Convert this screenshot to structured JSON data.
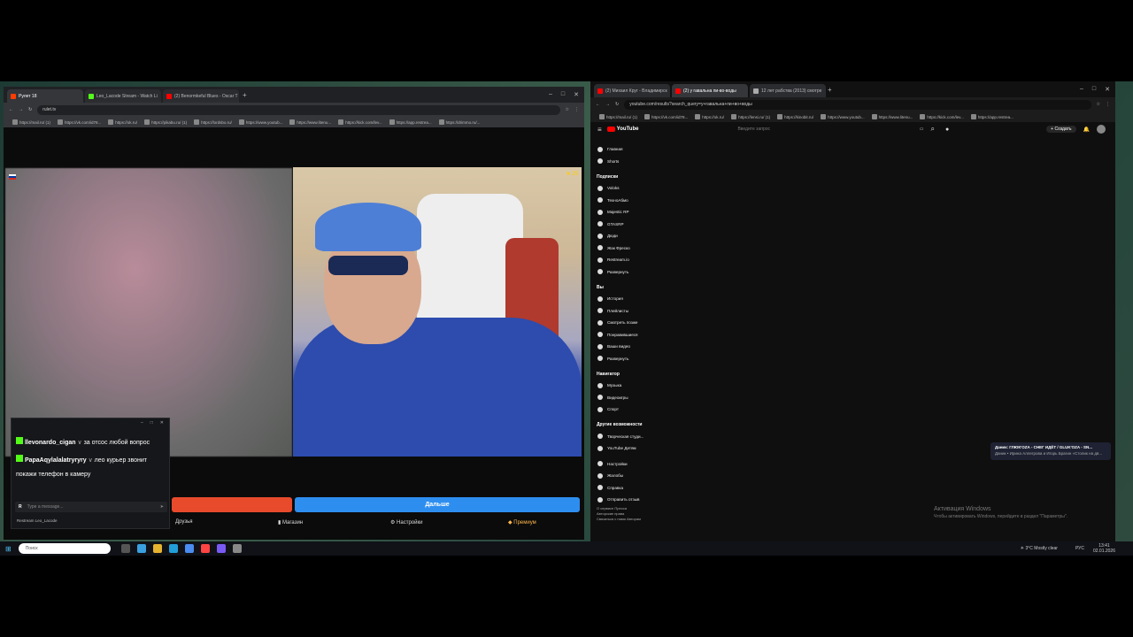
{
  "left_browser": {
    "tabs": [
      {
        "label": "Рулет 18",
        "color": "#ff3d00"
      },
      {
        "label": "Leo_Lacode Stream - Watch Li",
        "color": "#53fc18"
      },
      {
        "label": "(2) Benormkeful Blues - Oscar T",
        "color": "#ff0000"
      }
    ],
    "url": "rulet.tv",
    "bookmarks": [
      "https://mail.ru/ (1)",
      "https://vk.com/id78...",
      "https://ok.ru/",
      "https://pikabu.ru/ (1)",
      "https://lordsbo.ru/",
      "https://www.youtub...",
      "https://www.litenu...",
      "https://kick.com/lev...",
      "https://app.restrea...",
      "https://drimmo.ru/..."
    ],
    "bottom_buttons": {
      "next": "Дальше"
    },
    "menu": {
      "friends": "Друзья",
      "shop": "Магазин",
      "settings": "Настройки",
      "premium": "Премиум"
    },
    "stream_label": "Restream Leo_Lacode",
    "chat_input_placeholder": "Type a message...",
    "chat": [
      {
        "user": "llevonardo_cigan",
        "text": "за отсос любой вопрос"
      },
      {
        "user": "PapaAqylalalatryryry",
        "text": "лео курьер звонит покажи телефон в камеру"
      }
    ],
    "corner_badge": "25"
  },
  "right_browser": {
    "tabs": [
      {
        "label": "(2) Михаил Круг - Владимирск",
        "color": "#ff0000"
      },
      {
        "label": "(2) у гавальна пи-во-воды",
        "color": "#ff0000"
      },
      {
        "label": "12 лет рабства (2013) смотре",
        "color": "#aaaaaa"
      }
    ],
    "url": "youtube.com/results?search_query=у+гавальна+пи+во+воды",
    "bookmarks": [
      "https://mail.ru/ (1)",
      "https://vk.com/id78...",
      "https://ok.ru/",
      "https://lensi.ru/ (1)",
      "https://kinobit.ru/",
      "https://www.youtub...",
      "https://www.litenu...",
      "https://kick.com/lev...",
      "https://app.restrea..."
    ],
    "yt": {
      "logo": "YouTube",
      "search_placeholder": "Введите запрос",
      "create": "Создать",
      "main": [
        "Главная",
        "Shorts"
      ],
      "subs_header": "Подписки",
      "subs": [
        "Voloks",
        "ТехноАбмо",
        "Majestic RP",
        "GTASRP",
        "Дюди",
        "Жак Фреско",
        "Restream.io"
      ],
      "expand": "Развернуть",
      "you_header": "Вы",
      "you": [
        "История",
        "Плейлисты",
        "Смотреть позже",
        "Понравившиеся",
        "Ваши видео"
      ],
      "expand2": "Развернуть",
      "nav_header": "Навигатор",
      "nav": [
        "Музыка",
        "Видеоигры",
        "Спорт"
      ],
      "more_header": "Другие возможности",
      "more": [
        "Творческая студи...",
        "YouTube Детям"
      ],
      "settings": [
        "Настройки",
        "Жалобы",
        "Справка",
        "Отправить отзыв"
      ],
      "footer": [
        "О сервисе  Пресса",
        "Авторские права",
        "Связаться с нами  Авторам"
      ]
    },
    "mini_player": {
      "title": "Даник: ГЛЮК'OZA - СНЕГ ИДЁТ / GLUK'OZA - SN...",
      "subtitle": "Даник • Ирина Аллегрова и Игорь Брагин «Столик на дв..."
    },
    "activation": {
      "title": "Активация Windows",
      "subtitle": "Чтобы активировать Windows, перейдите в раздел \"Параметры\"."
    }
  },
  "taskbar": {
    "search_placeholder": "Поиск",
    "weather": "3°C  Mostly clear",
    "lang": "РУС",
    "time": "13:41",
    "date": "02.01.2026"
  }
}
